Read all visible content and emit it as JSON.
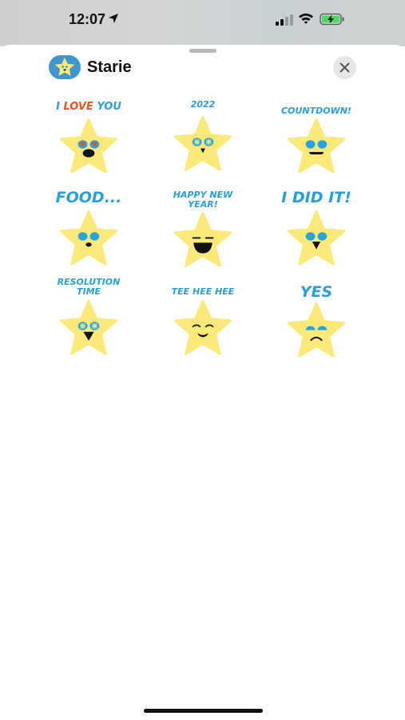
{
  "status_bar": {
    "time": "12:07",
    "icons": [
      "location-arrow-icon",
      "cellular-signal-icon",
      "wifi-icon",
      "battery-charging-icon"
    ]
  },
  "sheet": {
    "app_name": "Starie",
    "app_icon": "star-face-icon",
    "close_icon": "close-icon"
  },
  "colors": {
    "caption": "#2a9fd6",
    "caption_accent": "#e7541f",
    "star": "#fbe97a",
    "eyes": "#29a3dc",
    "heart_eyes": "#e7541f"
  },
  "stickers": [
    {
      "caption_parts": [
        "I ",
        "LOVE",
        " YOU"
      ],
      "face": "heart-eyes"
    },
    {
      "caption": "2022",
      "face": "sparkle-eyes-tongue"
    },
    {
      "caption": "COUNTDOWN!",
      "face": "grin-line"
    },
    {
      "caption": "FOOD...",
      "face": "small-mouth"
    },
    {
      "caption_lines": [
        "HAPPY NEW",
        "YEAR!"
      ],
      "face": "big-laugh"
    },
    {
      "caption": "I DID IT!",
      "face": "triangle-mouth"
    },
    {
      "caption_lines": [
        "RESOLUTION",
        "TIME"
      ],
      "face": "sparkle-triangle"
    },
    {
      "caption": "TEE HEE HEE",
      "face": "giggle"
    },
    {
      "caption": "YES",
      "face": "frown"
    }
  ]
}
